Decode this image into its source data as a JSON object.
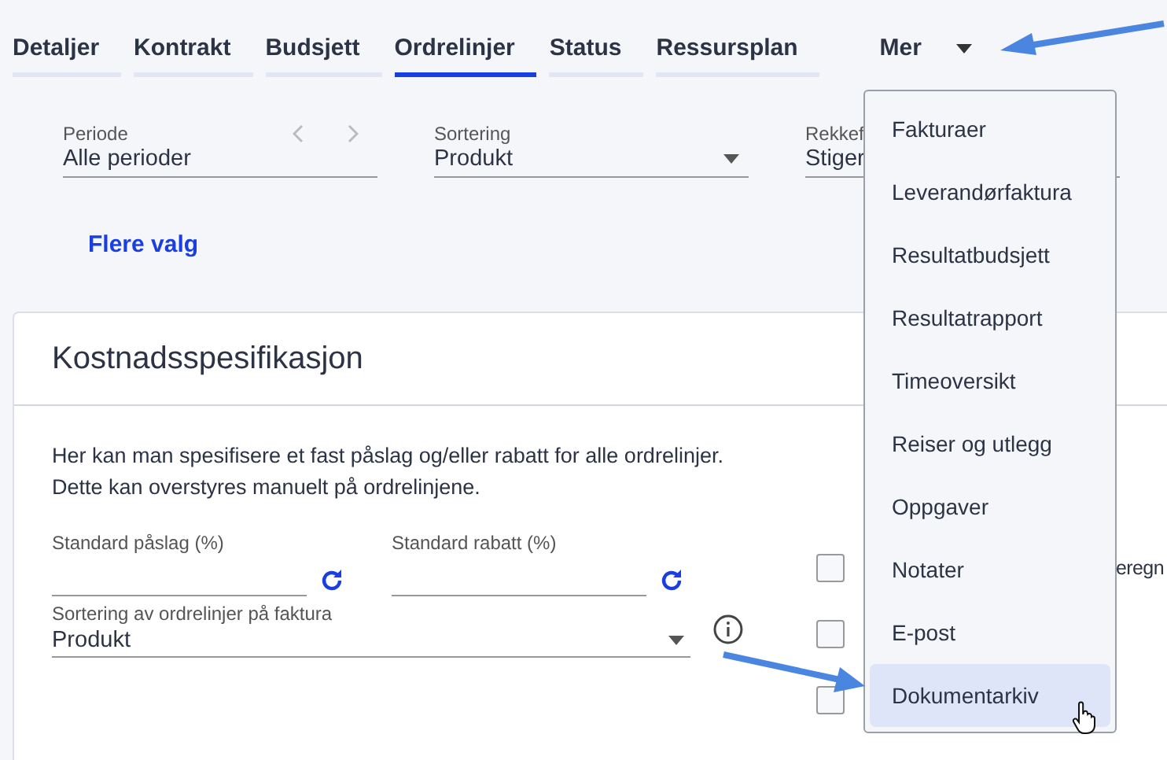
{
  "tabs": [
    {
      "label": "Detaljer",
      "selected": false,
      "kind": "tab"
    },
    {
      "label": "Kontrakt",
      "selected": false,
      "kind": "tab"
    },
    {
      "label": "Budsjett",
      "selected": false,
      "kind": "tab"
    },
    {
      "label": "Ordrelinjer",
      "selected": true,
      "kind": "tab"
    },
    {
      "label": "Status",
      "selected": false,
      "kind": "tab"
    },
    {
      "label": "Ressursplan",
      "selected": false,
      "kind": "tab"
    },
    {
      "label": "Mer",
      "selected": false,
      "kind": "dropdown"
    }
  ],
  "filters": [
    {
      "label": "Periode",
      "value": "Alle perioder",
      "kind": "period"
    },
    {
      "label": "Sortering",
      "value": "Produkt",
      "kind": "select"
    },
    {
      "label": "Rekkef",
      "value": "Stiger",
      "kind": "text"
    }
  ],
  "more_link": "Flere valg",
  "card": {
    "title": "Kostnadsspesifikasjon",
    "description": [
      "Her kan man spesifisere et fast påslag og/eller rabatt for alle ordrelinjer.",
      "Dette kan overstyres manuelt på ordrelinjene."
    ],
    "fields": [
      {
        "label": "Standard påslag (%)"
      },
      {
        "label": "Standard rabatt (%)"
      }
    ],
    "sort_field": {
      "label": "Sortering av ordrelinjer på faktura",
      "value": "Produkt"
    },
    "checkboxes": [
      {
        "label_end": "eregn",
        "checked": false
      },
      {
        "checked": false
      },
      {
        "checked": false
      }
    ]
  },
  "menu": {
    "items": [
      {
        "label": "Fakturaer",
        "selected": false
      },
      {
        "label": "Leverandørfaktura",
        "selected": false
      },
      {
        "label": "Resultatbudsjett",
        "selected": false
      },
      {
        "label": "Resultatrapport",
        "selected": false
      },
      {
        "label": "Timeoversikt",
        "selected": false
      },
      {
        "label": "Reiser og utlegg",
        "selected": false
      },
      {
        "label": "Oppgaver",
        "selected": false
      },
      {
        "label": "Notater",
        "selected": false
      },
      {
        "label": "E-post",
        "selected": false
      },
      {
        "label": "Dokumentarkiv",
        "selected": true
      }
    ]
  }
}
